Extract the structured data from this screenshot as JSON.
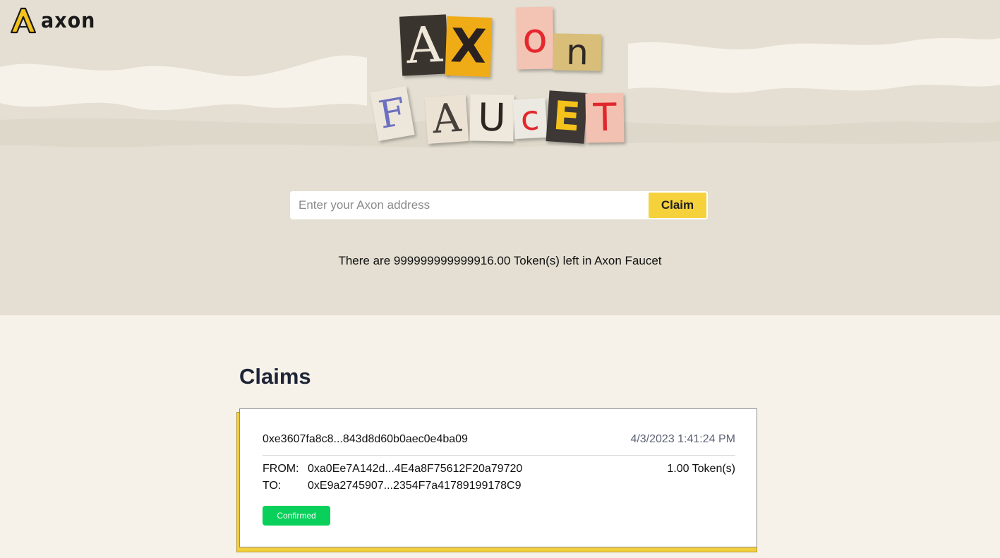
{
  "header": {
    "logo_text": "axon"
  },
  "title": {
    "word1": [
      "A",
      "X",
      "o",
      "n"
    ],
    "word2": [
      "F",
      "A",
      "U",
      "c",
      "E",
      "T"
    ]
  },
  "form": {
    "placeholder": "Enter your Axon address",
    "value": "",
    "claim_label": "Claim"
  },
  "remaining_text": "There are 999999999999916.00 Token(s) left in Axon Faucet",
  "claims": {
    "heading": "Claims",
    "items": [
      {
        "tx_hash": "0xe3607fa8c8...843d8d60b0aec0e4ba09",
        "time": "4/3/2023 1:41:24 PM",
        "from_label": "FROM:",
        "from": "0xa0Ee7A142d...4E4a8F75612F20a79720",
        "to_label": "TO:",
        "to": "0xE9a2745907...2354F7a41789199178C9",
        "amount": "1.00 Token(s)",
        "status": "Confirmed"
      }
    ]
  },
  "colors": {
    "accent": "#f5d13c",
    "status_confirmed": "#08d05a",
    "heading": "#1d2436"
  }
}
